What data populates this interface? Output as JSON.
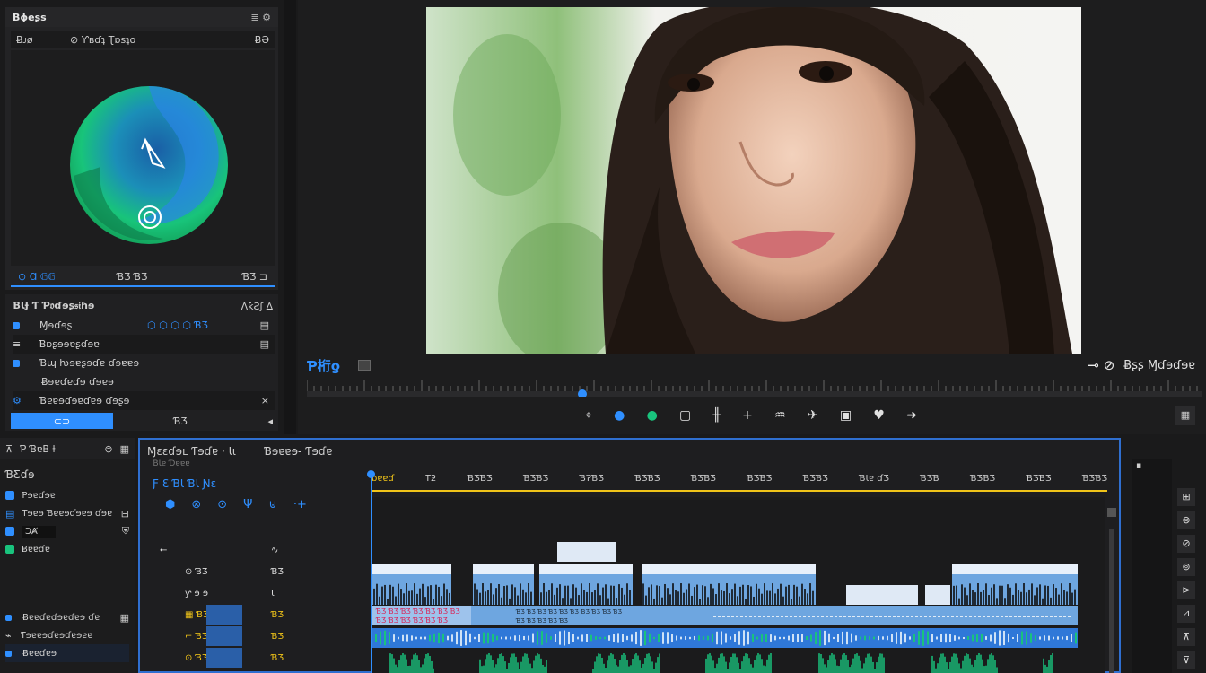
{
  "colors": {
    "accent": "#2f8fff",
    "playhead": "#f0c419",
    "bg": "#1a1a1b",
    "panel": "#202022",
    "green": "#19c37d",
    "clipBlue": "#6ea6e0",
    "clipLight": "#dfe9f5"
  },
  "wheel_panel": {
    "title": "Bϕeʂs",
    "header_right": "≣ ⚙",
    "sub_left": "Ƀᴊø",
    "sub_mid": "⊘ Ƴʙɗʇ Ʈɒsʇo",
    "sub_right": "ɃƏ",
    "tabs": [
      {
        "icon": "target-icon",
        "label": "Ɑ 𝔾𝔾"
      },
      {
        "label": "ƁƷ ƁƷ"
      },
      {
        "label": "ƁƷ ⊐"
      }
    ]
  },
  "effects_panel": {
    "title": "ƁƖɈ Ƭ Ƥ𝔬ɗɘʂ𝔰𝔦ɦɘ",
    "title_right": "ɅƙƧʃ ∆",
    "rows": [
      {
        "label": "Ɱɘɗɘʂ",
        "extra": "⬡ ⬡ ⬡ ⬡ ƁƷ",
        "icon": "square"
      },
      {
        "label": "Ɓɒʂɘɘɐʂɗɘɐ",
        "icon": "list"
      },
      {
        "label": "Ɓɰ ƕɘɐʂɘɗɐ ɗɘɐɐɘ",
        "icon": "square"
      },
      {
        "label": "Ƀɘɐɗɐɗɘ ɗɘɐɘ",
        "icon": "none"
      },
      {
        "label": "Ɓɐɐɘɗɘɐɗɐɘ ɗɘʂɘ",
        "icon": "gear"
      }
    ],
    "bottom_tabs": [
      "⊂⊃",
      "ƁƷ",
      "◂"
    ]
  },
  "viewer": {
    "label": "Ƥ桁ƍ",
    "right_label": "Ƀʂʂ Ɱɗɘɗɘɐ",
    "transport": [
      {
        "name": "crop-icon",
        "glyph": "⌖"
      },
      {
        "name": "color-pin-icon",
        "glyph": "●"
      },
      {
        "name": "record-icon",
        "glyph": "●"
      },
      {
        "name": "frame-icon",
        "glyph": "▢"
      },
      {
        "name": "waveform-icon",
        "glyph": "╫"
      },
      {
        "name": "add-marker-icon",
        "glyph": "+"
      },
      {
        "name": "audio-icon",
        "glyph": "♒"
      },
      {
        "name": "razor-icon",
        "glyph": "✈"
      },
      {
        "name": "film-icon",
        "glyph": "▣"
      },
      {
        "name": "heart-icon",
        "glyph": "♥"
      },
      {
        "name": "next-icon",
        "glyph": "➜"
      }
    ],
    "end_icon": "▦"
  },
  "left_bottom": {
    "toolbar": [
      "⊼",
      "Ƥ ƁɐɃ ƚ",
      "⊜",
      "▦"
    ],
    "section": "ƁƸɗɘ",
    "items": [
      {
        "label": "Ƥɘɐɗɘɐ",
        "icon": "square-blue"
      },
      {
        "label": "Ƭɘɐɘ Ɓɐɐɘɗɘɐɘ ɗɘɐ",
        "icon": "list",
        "right": "⊟"
      },
      {
        "label": "ƆȺ",
        "icon": "square-blue",
        "right": "⛨"
      },
      {
        "label": "Ƀɐɐɗɐ",
        "icon": "square-green"
      }
    ],
    "items2": [
      {
        "label": "Ƀɐɐɗɐɗɘɐɗɐɘ ɗɐ",
        "right": "▦"
      },
      {
        "label": "Ƭɘɐɐɘɗɐɘɗɐɘɐɐ"
      },
      {
        "label": "Ƀɐɐɗɐɘ"
      }
    ]
  },
  "timeline": {
    "title": "Ɱɛɛɗɘʟ Ƭɘɗɐ · Ɩɩ",
    "title2": "Ɓɘɐɐɘ- Ƭɘɗɐ",
    "sub": "ƁƖɐ Ɗɐɐɐ",
    "blue_labels": "Ƒ Ɛ ƁƖ ƁƖ Ɲɛ",
    "tool_icons": [
      "⬢",
      "⊗",
      "⊙",
      "Ψ",
      "⊍",
      "·+"
    ],
    "ruler": [
      "ƀɐɐɗ",
      "Ƭƻ",
      "ƁƷƁƷ",
      "ƁƷƁƷ",
      "ƁɁƁƷ",
      "ƁƷƁƷ",
      "ƁƷƁƷ",
      "ƁƷƁƷ",
      "ƁƷƁƷ",
      "ƁƖɐ ɗƷ",
      "ƁƷƁ",
      "ƁƷƁƷ",
      "ƁƷƁƷ",
      "ƁƷƁƷ"
    ],
    "track_controls": [
      {
        "left": "←",
        "right": "∿"
      },
      {
        "left": "⊙ ƁƷ",
        "right": "ƁƷ"
      },
      {
        "left": "ƴ ɘ ɘ",
        "right": "Ɩ"
      },
      {
        "left": "▦ ƁƷ",
        "right": "ƁƷ",
        "highlight": true
      },
      {
        "left": "⌐ ƁƷ",
        "right": "ƁƷ",
        "highlight": true
      },
      {
        "left": "⊙ ƁƷ",
        "right": "ƁƷ",
        "highlight": true
      }
    ]
  },
  "right_tools": [
    "⊞",
    "⊗",
    "⊘",
    "⊚",
    "⊳",
    "⊿",
    "⊼",
    "⊽"
  ]
}
